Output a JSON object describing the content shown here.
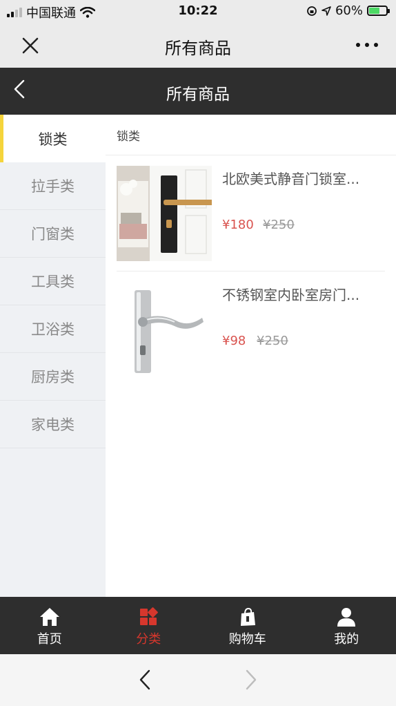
{
  "status_bar": {
    "carrier": "中国联通",
    "time": "10:22",
    "battery": "60%"
  },
  "wechat_nav": {
    "title": "所有商品"
  },
  "page_header": {
    "title": "所有商品"
  },
  "sidebar": {
    "items": [
      {
        "label": "锁类",
        "active": true
      },
      {
        "label": "拉手类"
      },
      {
        "label": "门窗类"
      },
      {
        "label": "工具类"
      },
      {
        "label": "卫浴类"
      },
      {
        "label": "厨房类"
      },
      {
        "label": "家电类"
      }
    ]
  },
  "content": {
    "section_title": "锁类",
    "products": [
      {
        "name": "北欧美式静音门锁室...",
        "price": "¥180",
        "original_price": "¥250"
      },
      {
        "name": "不锈钢室内卧室房门...",
        "price": "¥98",
        "original_price": "¥250"
      }
    ]
  },
  "tab_bar": {
    "items": [
      {
        "label": "首页",
        "icon": "home-icon"
      },
      {
        "label": "分类",
        "icon": "category-icon",
        "active": true
      },
      {
        "label": "购物车",
        "icon": "shopping-bag-icon"
      },
      {
        "label": "我的",
        "icon": "user-icon"
      }
    ]
  },
  "colors": {
    "accent": "#d6372d",
    "price": "#d9534f",
    "sidebar_indicator": "#f5d43b",
    "dark_bar": "#2e2e2e"
  }
}
